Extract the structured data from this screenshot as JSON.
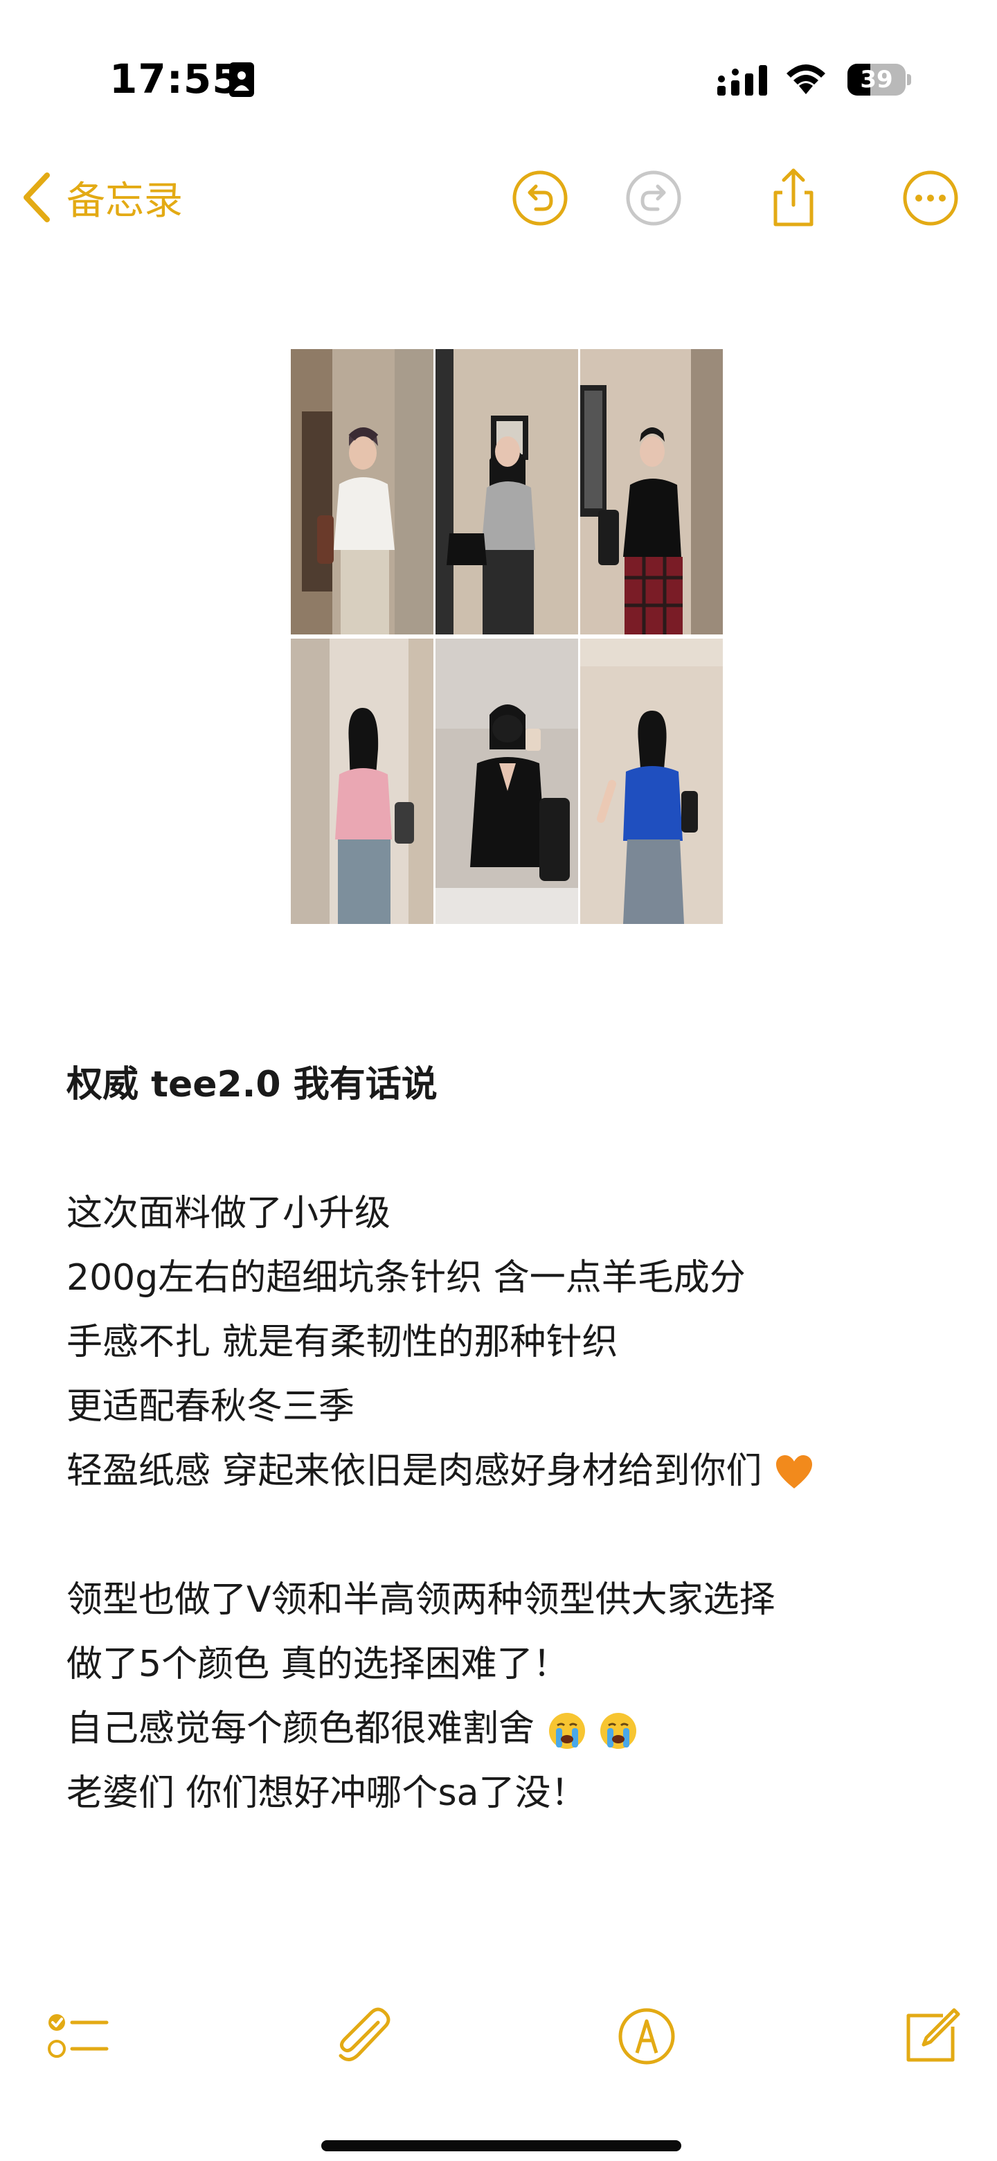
{
  "status_bar": {
    "time": "17:55",
    "battery_level": "39",
    "battery_fraction": 0.39,
    "icons": [
      "id-card-icon",
      "cellular-signal-icon",
      "wifi-icon",
      "battery-icon"
    ]
  },
  "nav": {
    "back_label": "备忘录",
    "buttons": [
      "undo-icon",
      "redo-icon",
      "share-icon",
      "more-icon"
    ]
  },
  "colors": {
    "accent": "#e3aa14",
    "disabled": "#c8c8c8",
    "text": "#1a1a1a"
  },
  "note": {
    "title": "权威 tee2.0 我有话说",
    "paragraph1": [
      "这次面料做了小升级",
      "200g左右的超细坑条针织 含一点羊毛成分",
      "手感不扎 就是有柔韧性的那种针织",
      "更适配春秋冬三季",
      "轻盈纸感 穿起来依旧是肉感好身材给到你们"
    ],
    "paragraph2": [
      "领型也做了V领和半高领两种领型供大家选择",
      "做了5个颜色 真的选择困难了！",
      "自己感觉每个颜色都很难割舍",
      "老婆们 你们想好冲哪个sa了没！"
    ],
    "emojis": [
      "orange-heart-icon",
      "crying-face-icon",
      "crying-face-icon"
    ]
  },
  "photos": [
    {
      "name": "photo-white-top"
    },
    {
      "name": "photo-grey-top"
    },
    {
      "name": "photo-black-top-plaid-skirt"
    },
    {
      "name": "photo-pink-top"
    },
    {
      "name": "photo-black-vneck-top"
    },
    {
      "name": "photo-blue-top"
    }
  ],
  "toolbar": {
    "buttons": [
      "checklist-icon",
      "attachment-icon",
      "markup-icon",
      "compose-icon"
    ]
  }
}
